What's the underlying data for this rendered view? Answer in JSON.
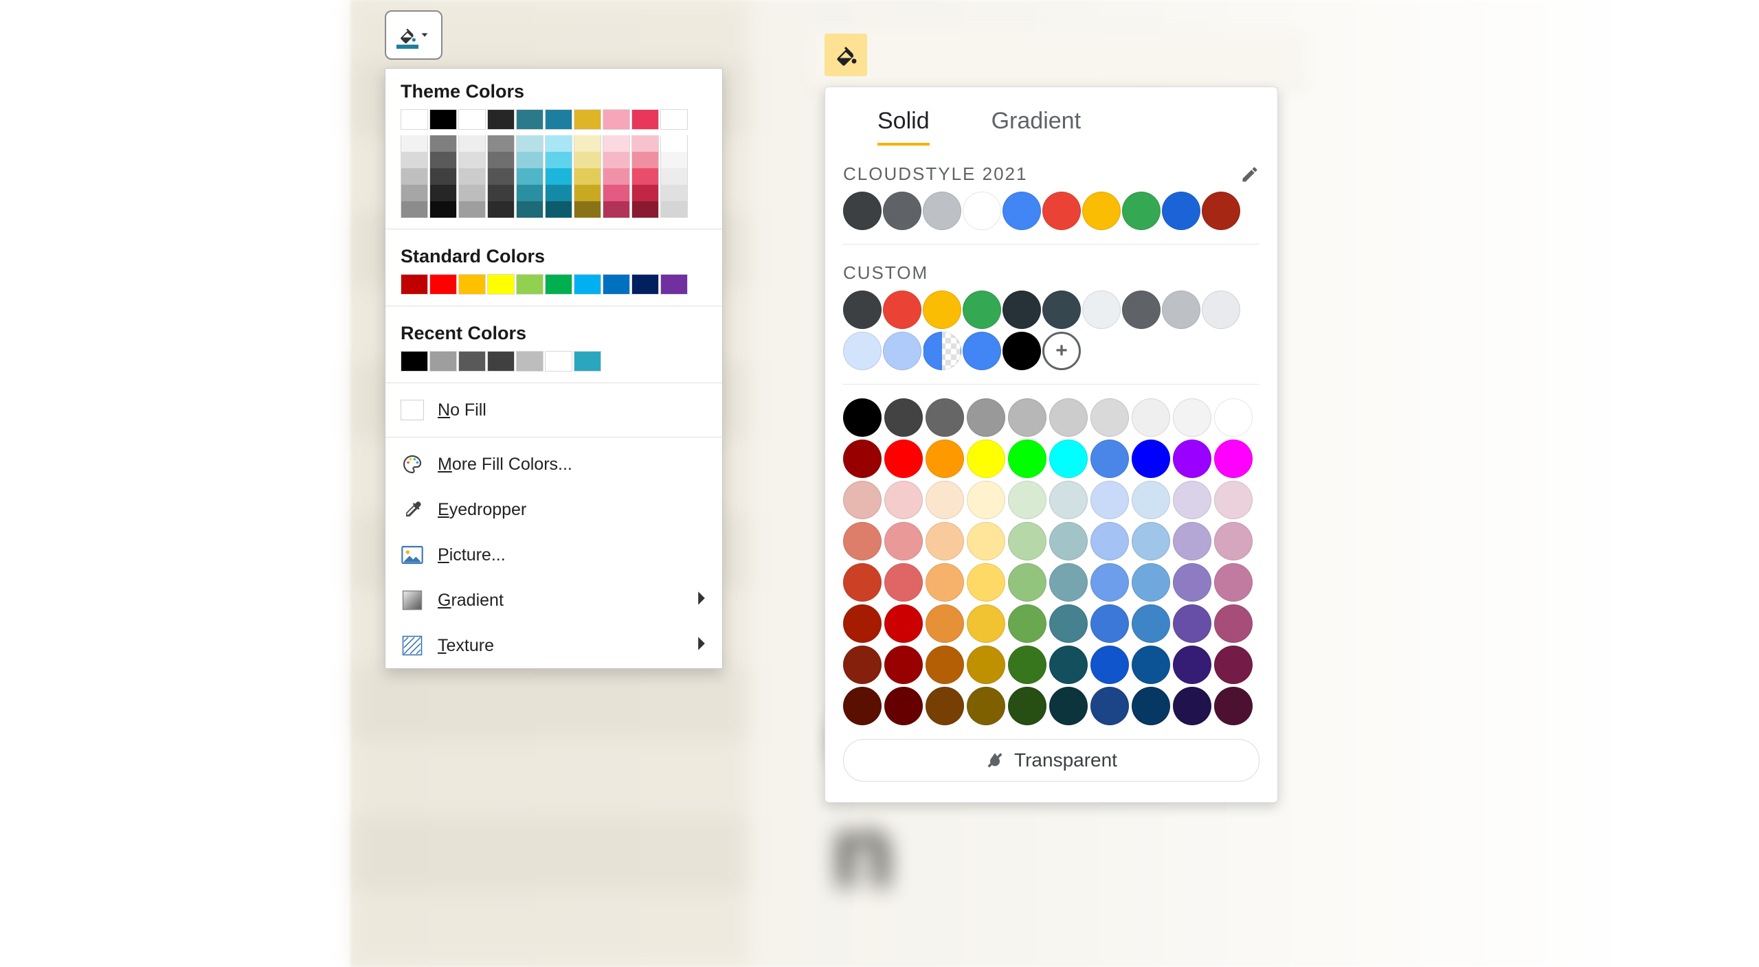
{
  "office": {
    "theme_label": "Theme Colors",
    "standard_label": "Standard Colors",
    "recent_label": "Recent Colors",
    "theme_row": [
      "#ffffff",
      "#000000",
      "#ffffff",
      "#262626",
      "#2b7a8c",
      "#1d7fa0",
      "#e0b427",
      "#f6a6b8",
      "#e9375c",
      "#ffffff"
    ],
    "tints": [
      [
        "#f2f2f2",
        "#d9d9d9",
        "#bfbfbf",
        "#a6a6a6",
        "#8c8c8c"
      ],
      [
        "#7f7f7f",
        "#595959",
        "#404040",
        "#262626",
        "#0d0d0d"
      ],
      [
        "#eeeeee",
        "#dddddd",
        "#cccccc",
        "#bdbdbd",
        "#9e9e9e"
      ],
      [
        "#8a8a8a",
        "#6e6e6e",
        "#555555",
        "#3d3d3d",
        "#2b2b2b"
      ],
      [
        "#b6e0e8",
        "#8fd0dc",
        "#4fb6c8",
        "#2a8fa0",
        "#1d6b77"
      ],
      [
        "#a9e6f5",
        "#5fd2ec",
        "#1cb6da",
        "#148aa6",
        "#0d5c6e"
      ],
      [
        "#f6eec1",
        "#efe197",
        "#e3cd58",
        "#c9a922",
        "#8a7317"
      ],
      [
        "#fbd9e1",
        "#f6b8c7",
        "#f191a8",
        "#e45a80",
        "#b23358"
      ],
      [
        "#f7c2cd",
        "#f18fa2",
        "#e94d6a",
        "#c22645",
        "#8a1a30"
      ],
      [
        "#ffffff",
        "#f5f5f5",
        "#ececec",
        "#e0e0e0",
        "#d5d5d5"
      ]
    ],
    "standard": [
      "#c00000",
      "#ff0000",
      "#ffc000",
      "#ffff00",
      "#92d050",
      "#00b050",
      "#00b0f0",
      "#0070c0",
      "#002060",
      "#7030a0"
    ],
    "recent": [
      "#000000",
      "#9e9e9e",
      "#595959",
      "#404040",
      "#bdbdbd",
      "#ffffff",
      "#2aa7bf"
    ],
    "items": {
      "no_fill": {
        "text_pre": "",
        "key": "N",
        "text_post": "o Fill"
      },
      "more": {
        "text_pre": "",
        "key": "M",
        "text_post": "ore Fill Colors..."
      },
      "eyedropper": {
        "text_pre": "",
        "key": "E",
        "text_post": "yedropper"
      },
      "picture": {
        "text_pre": "",
        "key": "P",
        "text_post": "icture..."
      },
      "gradient": {
        "text_pre": "",
        "key": "G",
        "text_post": "radient"
      },
      "texture": {
        "text_pre": "",
        "key": "T",
        "text_post": "exture"
      }
    }
  },
  "google": {
    "tabs": {
      "solid": "Solid",
      "gradient": "Gradient"
    },
    "theme_label": "CLOUDSTYLE 2021",
    "custom_label": "CUSTOM",
    "theme": [
      "#3c4043",
      "#5f6368",
      "#bdc1c6",
      "#ffffff",
      "#4285f4",
      "#ea4335",
      "#fbbc04",
      "#34a853",
      "#1b64d8",
      "#a52714"
    ],
    "custom_row1": [
      "#3c4043",
      "#ea4335",
      "#fbbc04",
      "#34a853",
      "#263238",
      "#37474f",
      "#eceff1",
      "#5f6368",
      "#bdc1c6",
      "#e8eaed"
    ],
    "custom_row2": [
      "#d2e3fc",
      "#aecbfa",
      "#8ab4f8",
      "#4285f4",
      "#000000"
    ],
    "custom_split_left": "#4285f4",
    "palette_rows": [
      [
        "#000000",
        "#434343",
        "#666666",
        "#999999",
        "#b7b7b7",
        "#cccccc",
        "#d9d9d9",
        "#efefef",
        "#f3f3f3",
        "#ffffff"
      ],
      [
        "#980000",
        "#ff0000",
        "#ff9900",
        "#ffff00",
        "#00ff00",
        "#00ffff",
        "#4a86e8",
        "#0000ff",
        "#9900ff",
        "#ff00ff"
      ],
      [
        "#e6b8af",
        "#f4cccc",
        "#fce5cd",
        "#fff2cc",
        "#d9ead3",
        "#d0e0e3",
        "#c9daf8",
        "#cfe2f3",
        "#d9d2e9",
        "#ead1dc"
      ],
      [
        "#dd7e6b",
        "#ea9999",
        "#f9cb9c",
        "#ffe599",
        "#b6d7a8",
        "#a2c4c9",
        "#a4c2f4",
        "#9fc5e8",
        "#b4a7d6",
        "#d5a6bd"
      ],
      [
        "#cc4125",
        "#e06666",
        "#f6b26b",
        "#ffd966",
        "#93c47d",
        "#76a5af",
        "#6d9eeb",
        "#6fa8dc",
        "#8e7cc3",
        "#c27ba0"
      ],
      [
        "#a61c00",
        "#cc0000",
        "#e69138",
        "#f1c232",
        "#6aa84f",
        "#45818e",
        "#3c78d8",
        "#3d85c6",
        "#674ea7",
        "#a64d79"
      ],
      [
        "#85200c",
        "#990000",
        "#b45f06",
        "#bf9000",
        "#38761d",
        "#134f5c",
        "#1155cc",
        "#0b5394",
        "#351c75",
        "#741b47"
      ],
      [
        "#5b0f00",
        "#660000",
        "#783f04",
        "#7f6000",
        "#274e13",
        "#0c343d",
        "#1c4587",
        "#073763",
        "#20124d",
        "#4c1130"
      ]
    ],
    "transparent_label": "Transparent"
  }
}
